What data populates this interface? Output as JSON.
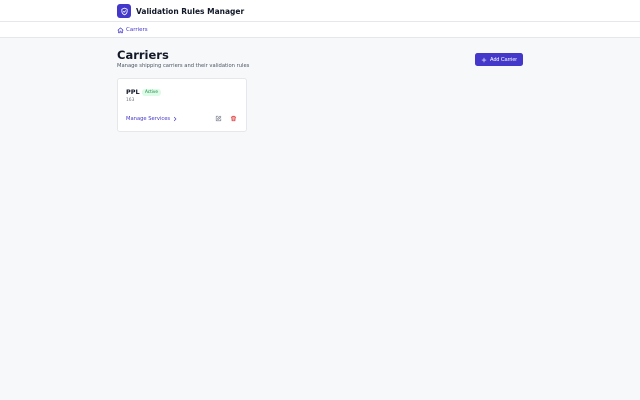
{
  "header": {
    "app_title": "Validation Rules Manager",
    "logo_icon": "shield-check-icon"
  },
  "breadcrumb": {
    "icon": "home-icon",
    "label": "Carriers"
  },
  "page": {
    "title": "Carriers",
    "subtitle": "Manage shipping carriers and their validation rules"
  },
  "actions": {
    "add_label": "Add Carrier",
    "add_icon": "plus-icon"
  },
  "carriers": [
    {
      "name": "PPL",
      "status": "Active",
      "code": "163",
      "manage_label": "Manage Services"
    }
  ],
  "colors": {
    "accent": "#4338ca",
    "badge_bg": "#dcfce7",
    "badge_text": "#15803d",
    "danger": "#dc2626",
    "page_bg": "#f7f8fa"
  }
}
